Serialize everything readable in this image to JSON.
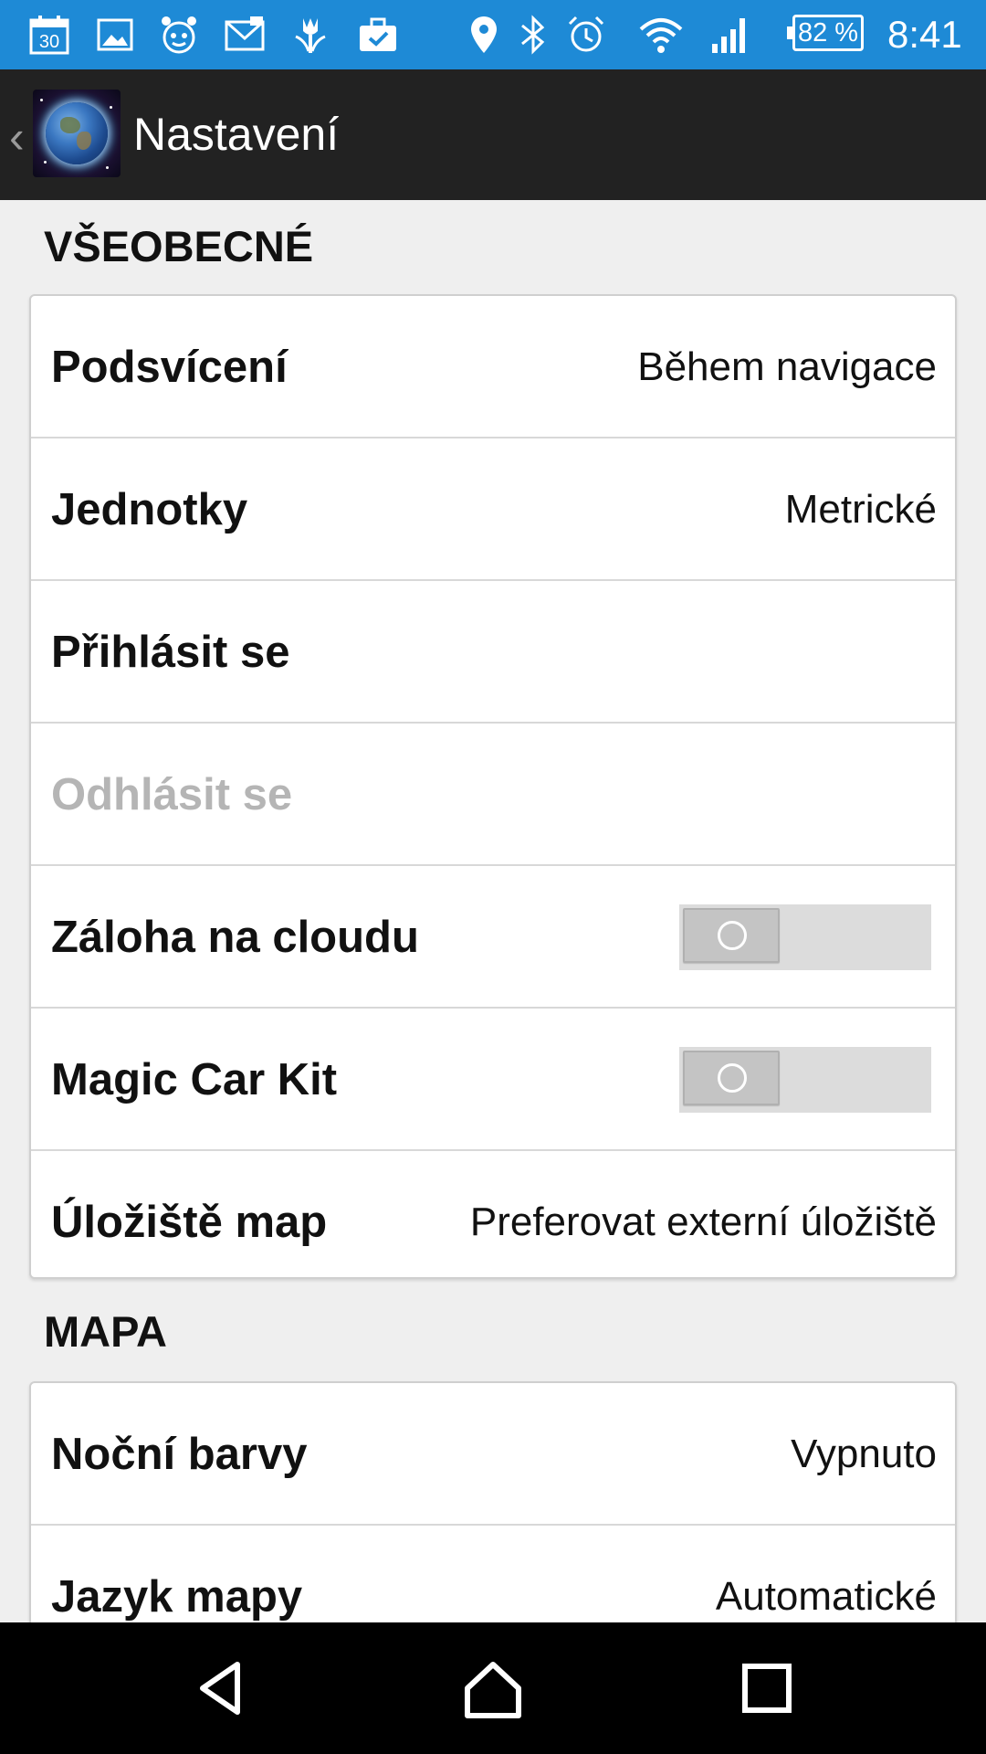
{
  "status_bar": {
    "battery": "82 %",
    "time": "8:41",
    "left_icons": [
      "calendar-icon",
      "gallery-icon",
      "alarm-app-icon",
      "email-icon",
      "tulip-icon",
      "briefcase-check-icon"
    ],
    "right_icons": [
      "location-icon",
      "bluetooth-icon",
      "alarm-icon",
      "wifi-icon",
      "signal-icon"
    ],
    "calendar_day": "30"
  },
  "action_bar": {
    "title": "Nastavení"
  },
  "sections": {
    "general": {
      "header": "VŠEOBECNÉ",
      "items": [
        {
          "label": "Podsvícení",
          "value": "Během navigace"
        },
        {
          "label": "Jednotky",
          "value": "Metrické"
        },
        {
          "label": "Přihlásit se"
        },
        {
          "label": "Odhlásit se",
          "disabled": true
        },
        {
          "label": "Záloha na cloudu",
          "toggle": false
        },
        {
          "label": "Magic Car Kit",
          "toggle": false
        },
        {
          "label": "Úložiště map",
          "value": "Preferovat externí úložiště"
        }
      ]
    },
    "map": {
      "header": "MAPA",
      "items": [
        {
          "label": "Noční barvy",
          "value": "Vypnuto"
        },
        {
          "label": "Jazyk mapy",
          "value": "Automatické"
        }
      ]
    }
  },
  "colors": {
    "status_bar": "#1e8ad6",
    "action_bar": "#222222",
    "background": "#efefef",
    "disabled_text": "#b5b5b5"
  },
  "nav_bar": {
    "icons": [
      "back-icon",
      "home-icon",
      "recents-icon"
    ]
  }
}
